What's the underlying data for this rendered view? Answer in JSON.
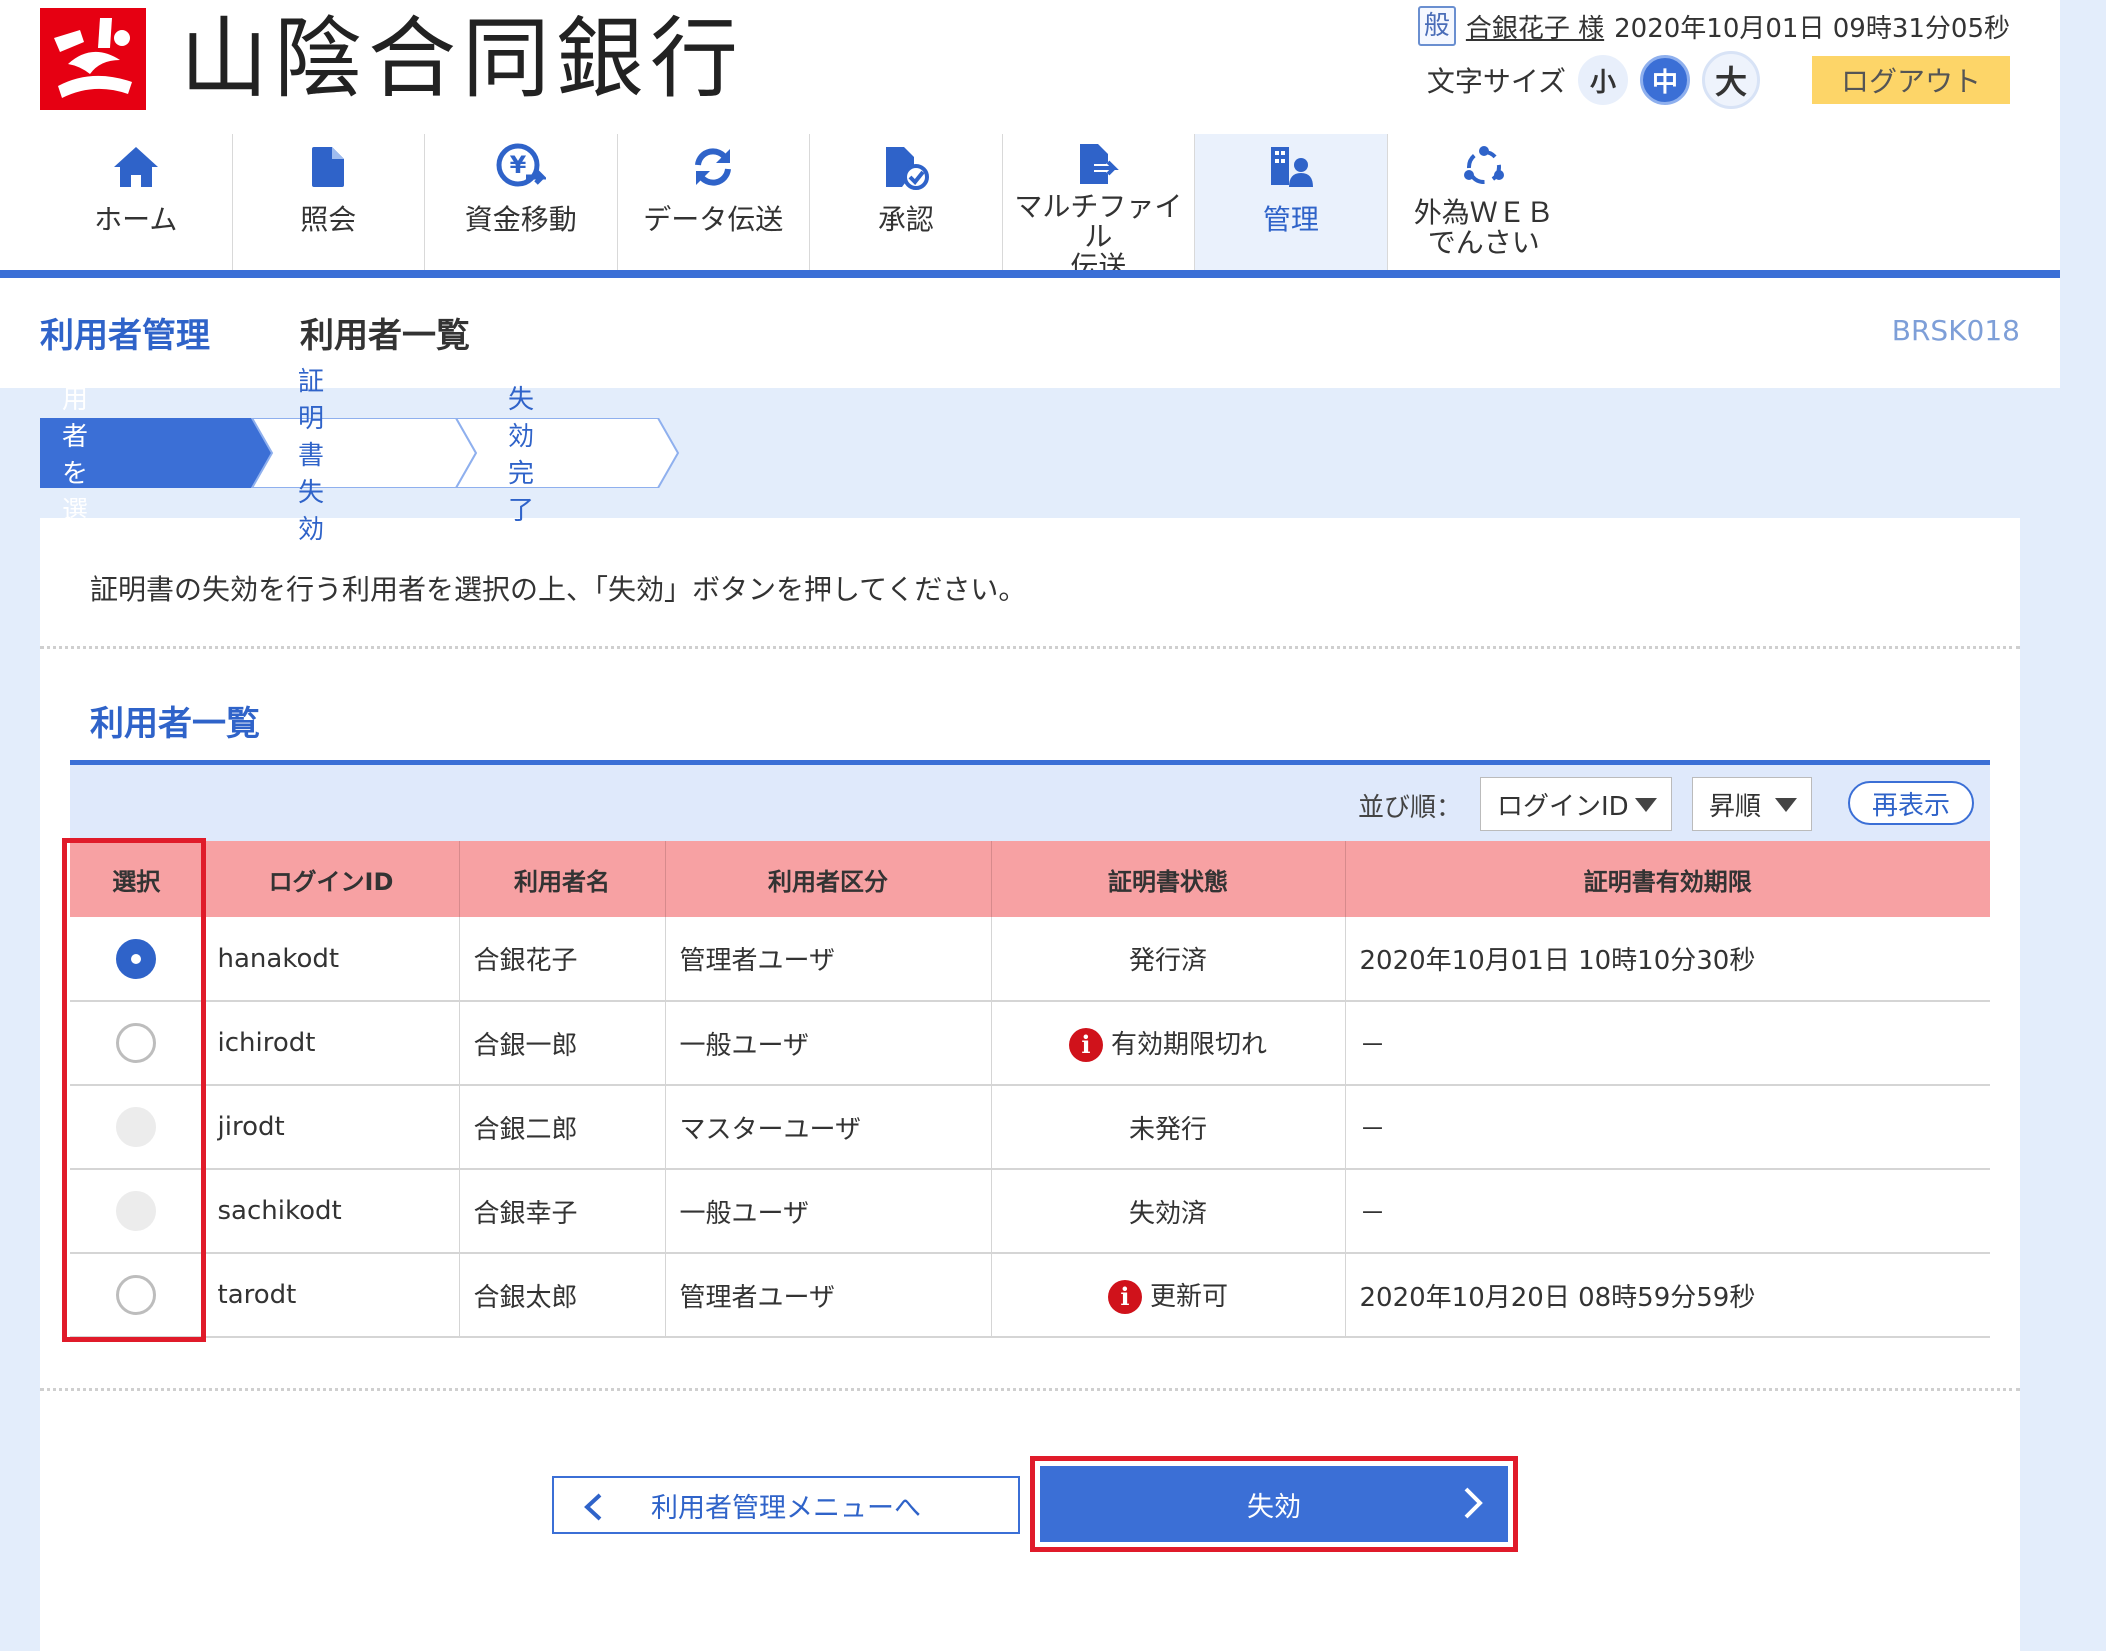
{
  "bank": {
    "name": "山陰合同銀行"
  },
  "user_bar": {
    "kind": "般",
    "name": "合銀花子 様",
    "datetime": "2020年10月01日 09時31分05秒"
  },
  "font_size": {
    "label": "文字サイズ",
    "small": "小",
    "medium": "中",
    "large": "大",
    "selected": "中"
  },
  "logout": "ログアウト",
  "nav": {
    "items": [
      {
        "label": "ホーム",
        "icon": "home-icon"
      },
      {
        "label": "照会",
        "icon": "document-icon"
      },
      {
        "label": "資金移動",
        "icon": "yen-transfer-icon"
      },
      {
        "label": "データ伝送",
        "icon": "refresh-icon"
      },
      {
        "label": "承認",
        "icon": "approve-document-icon"
      },
      {
        "label": "マルチファイル\n伝送",
        "icon": "file-send-icon"
      },
      {
        "label": "管理",
        "icon": "building-user-icon",
        "active": true
      },
      {
        "label": "外為ＷＥＢ\nでんさい",
        "icon": "cycle-icon"
      }
    ]
  },
  "page": {
    "section_title": "利用者管理",
    "title": "利用者一覧",
    "screen_id": "BRSK018"
  },
  "steps": [
    {
      "label": "利用者を選択",
      "current": true
    },
    {
      "label": "証明書失効",
      "current": false
    },
    {
      "label": "失効完了",
      "current": false
    }
  ],
  "instruction": "証明書の失効を行う利用者を選択の上、「失効」ボタンを押してください。",
  "list": {
    "title": "利用者一覧",
    "sort_label": "並び順：",
    "sort_field": "ログインID",
    "sort_order": "昇順",
    "redisplay": "再表示",
    "columns": [
      "選択",
      "ログインID",
      "利用者名",
      "利用者区分",
      "証明書状態",
      "証明書有効期限"
    ],
    "rows": [
      {
        "selected": true,
        "enabled": true,
        "login_id": "hanakodt",
        "name": "合銀花子",
        "type": "管理者ユーザ",
        "status": "発行済",
        "status_alert": false,
        "expiry": "2020年10月01日 10時10分30秒"
      },
      {
        "selected": false,
        "enabled": true,
        "login_id": "ichirodt",
        "name": "合銀一郎",
        "type": "一般ユーザ",
        "status": "有効期限切れ",
        "status_alert": true,
        "expiry": "－"
      },
      {
        "selected": false,
        "enabled": false,
        "login_id": "jirodt",
        "name": "合銀二郎",
        "type": "マスターユーザ",
        "status": "未発行",
        "status_alert": false,
        "expiry": "－"
      },
      {
        "selected": false,
        "enabled": false,
        "login_id": "sachikodt",
        "name": "合銀幸子",
        "type": "一般ユーザ",
        "status": "失効済",
        "status_alert": false,
        "expiry": "－"
      },
      {
        "selected": false,
        "enabled": true,
        "login_id": "tarodt",
        "name": "合銀太郎",
        "type": "管理者ユーザ",
        "status": "更新可",
        "status_alert": true,
        "expiry": "2020年10月20日 08時59分59秒"
      }
    ]
  },
  "buttons": {
    "back": "利用者管理メニューへ",
    "revoke": "失効"
  },
  "colors": {
    "brand_red": "#e60012",
    "accent_blue": "#3b6fd6",
    "header_pink": "#f7a1a3",
    "logout_yellow": "#fdd568",
    "highlight_red": "#e01b2a"
  }
}
